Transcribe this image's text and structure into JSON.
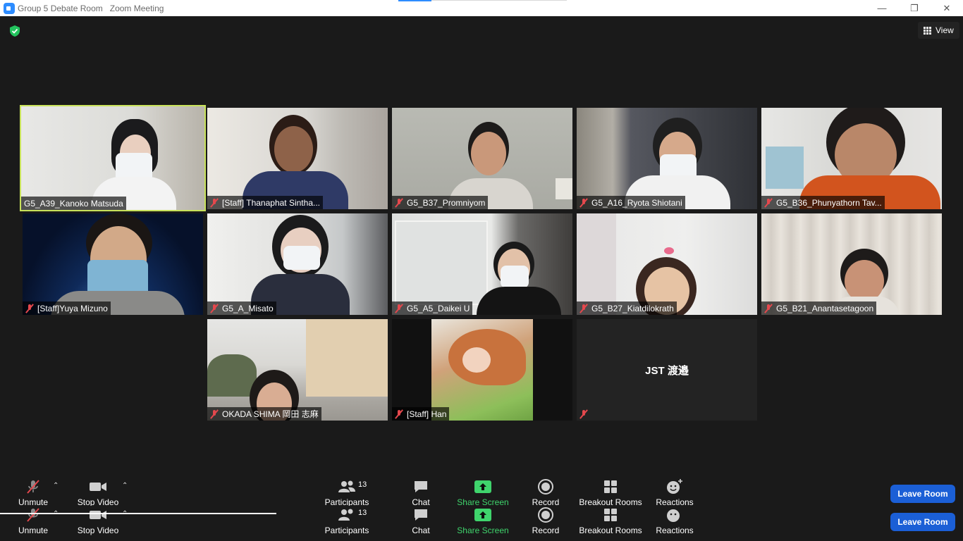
{
  "window": {
    "title": "Group 5 Debate Room   Zoom Meeting",
    "minimize": "—",
    "restore": "❐",
    "close": "✕"
  },
  "header": {
    "view_label": "View"
  },
  "participants_tiles": [
    {
      "name": "G5_A39_Kanoko Matsuda",
      "muted": false,
      "active_speaker": true
    },
    {
      "name": "[Staff] Thanaphat Sintha...",
      "muted": true
    },
    {
      "name": "G5_B37_Promniyom",
      "muted": true
    },
    {
      "name": "G5_A16_Ryota Shiotani",
      "muted": true
    },
    {
      "name": "G5_B36_Phunyathorn Tav...",
      "muted": true
    },
    {
      "name": "[Staff]Yuya Mizuno",
      "muted": true
    },
    {
      "name": "G5_A_Misato",
      "muted": true
    },
    {
      "name": "G5_A5_Daikei U",
      "muted": true
    },
    {
      "name": "G5_B27_Kiatdilokrath",
      "muted": true
    },
    {
      "name": "G5_B21_Anantasetagoon",
      "muted": true
    },
    {
      "name": "OKADA SHIMA 岡田 志麻",
      "muted": true
    },
    {
      "name": "[Staff] Han",
      "muted": true
    },
    {
      "name": "JST 渡邉",
      "muted": true,
      "video_off": true
    }
  ],
  "toolbar": {
    "unmute": "Unmute",
    "stop_video": "Stop Video",
    "participants": "Participants",
    "participants_count": "13",
    "chat": "Chat",
    "share_screen": "Share Screen",
    "record": "Record",
    "breakout_rooms": "Breakout Rooms",
    "reactions": "Reactions",
    "leave_room": "Leave Room",
    "caret": "⌃"
  },
  "colors": {
    "background": "#1a1a1a",
    "active_speaker_border": "#c8e25a",
    "share_screen_green": "#3fd46c",
    "leave_button": "#1b5fd6",
    "muted_red": "#e5484d"
  }
}
